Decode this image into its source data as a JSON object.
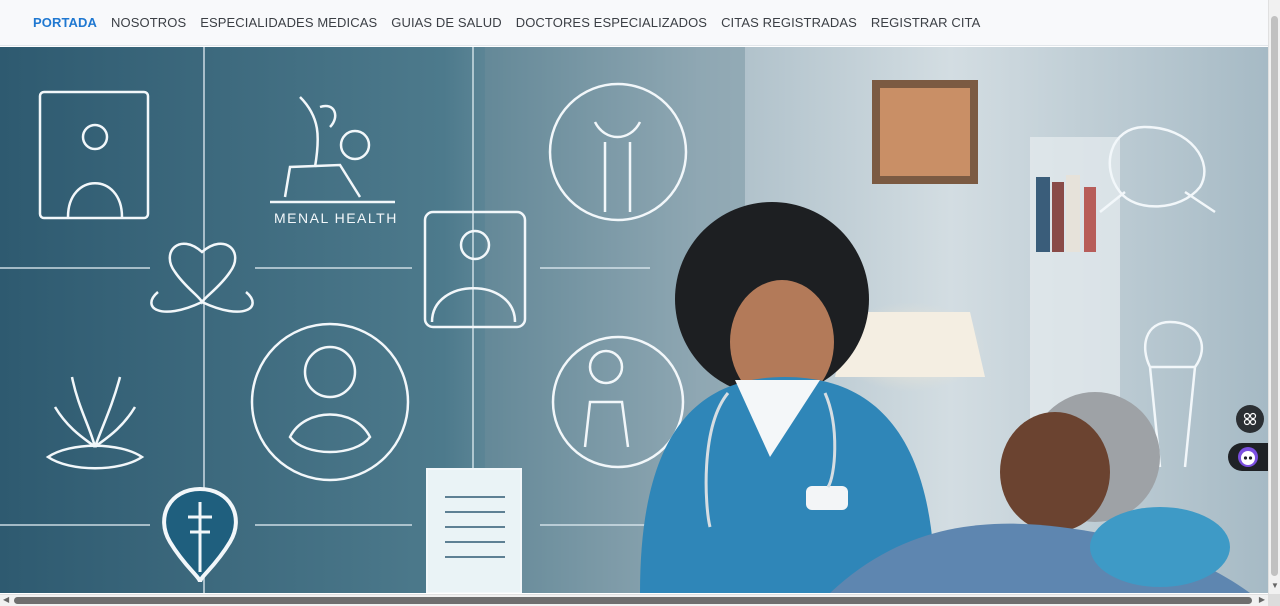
{
  "nav": {
    "items": [
      {
        "label": "PORTADA",
        "active": true
      },
      {
        "label": "NOSOTROS"
      },
      {
        "label": "ESPECIALIDADES MEDICAS"
      },
      {
        "label": "GUIAS DE SALUD"
      },
      {
        "label": "DOCTORES ESPECIALIZADOS"
      },
      {
        "label": "CITAS REGISTRADAS"
      },
      {
        "label": "REGISTRAR CITA"
      }
    ]
  },
  "hero": {
    "banner_text": "MENAL HEALTH"
  },
  "colors": {
    "accent": "#1f78d1",
    "nav_text": "#3b3f45",
    "hero_blue": "#2f5b73",
    "scrub_blue": "#2f86b8"
  },
  "widgets": {
    "floating_icon": "grid-icon",
    "chat_icon": "chat-bot-icon"
  }
}
